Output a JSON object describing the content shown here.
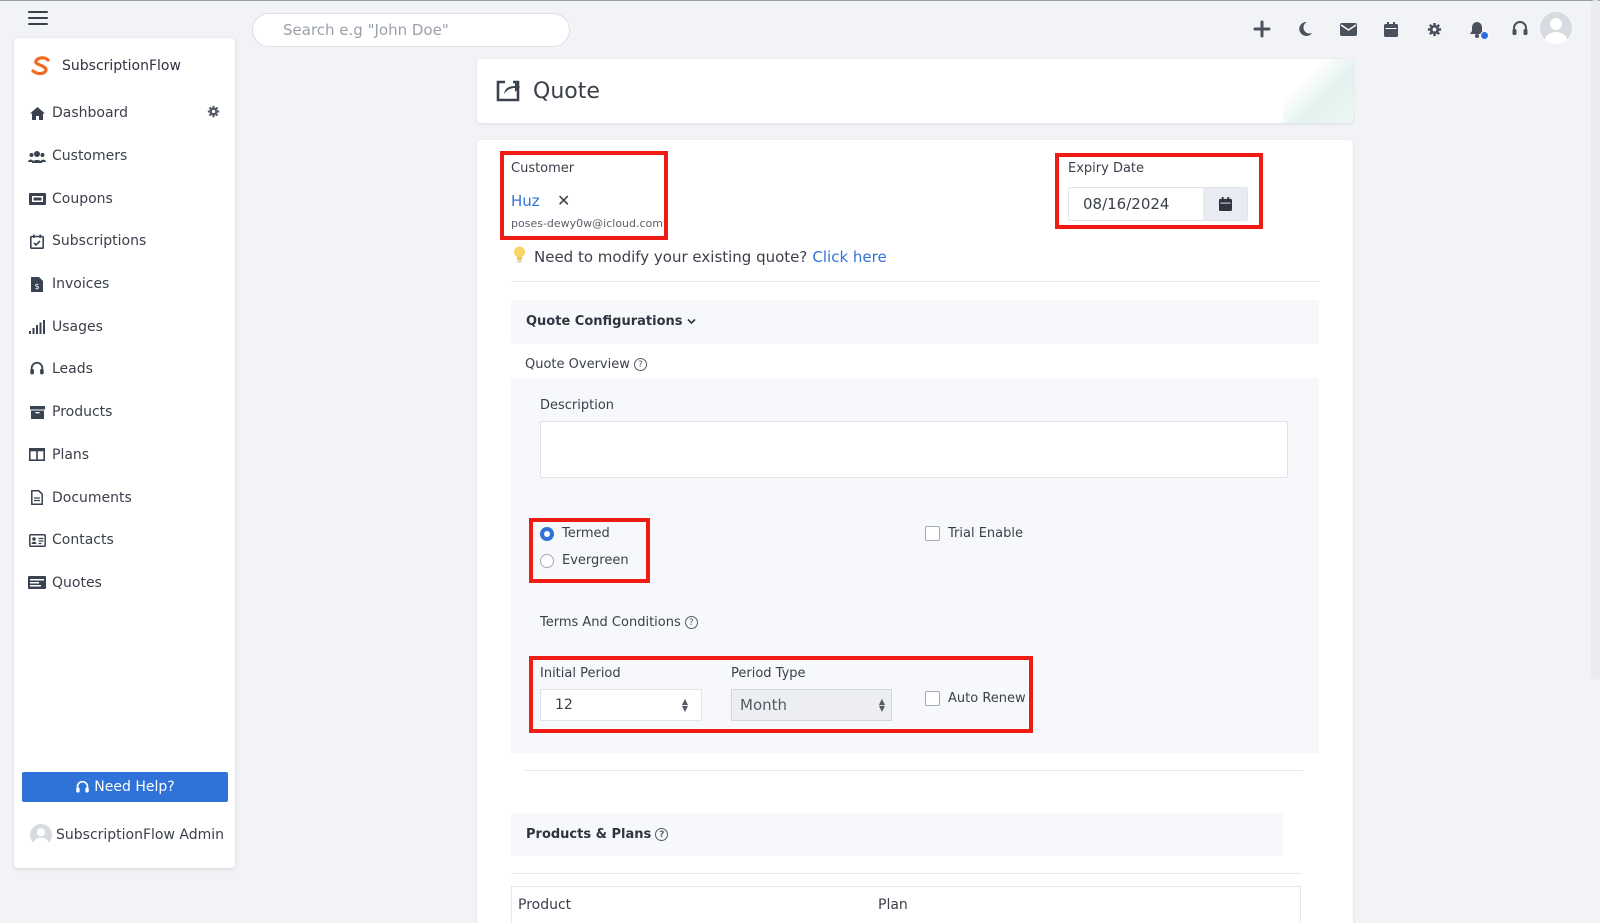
{
  "topbar": {
    "search_placeholder": "Search e.g \"John Doe\"",
    "icons": [
      "plus-icon",
      "moon-icon",
      "mail-icon",
      "calendar-icon",
      "gear-icon",
      "bell-icon",
      "headset-icon",
      "avatar"
    ]
  },
  "sidebar": {
    "brand": "SubscriptionFlow",
    "items": [
      {
        "label": "Dashboard",
        "icon": "home-icon"
      },
      {
        "label": "Customers",
        "icon": "users-icon"
      },
      {
        "label": "Coupons",
        "icon": "coupon-icon"
      },
      {
        "label": "Subscriptions",
        "icon": "calendar-check-icon"
      },
      {
        "label": "Invoices",
        "icon": "invoice-icon"
      },
      {
        "label": "Usages",
        "icon": "signal-icon"
      },
      {
        "label": "Leads",
        "icon": "headset-icon"
      },
      {
        "label": "Products",
        "icon": "archive-icon"
      },
      {
        "label": "Plans",
        "icon": "columns-icon"
      },
      {
        "label": "Documents",
        "icon": "document-icon"
      },
      {
        "label": "Contacts",
        "icon": "contact-card-icon"
      },
      {
        "label": "Quotes",
        "icon": "quotes-icon"
      }
    ],
    "help_button": "Need Help?",
    "admin_name": "SubscriptionFlow Admin"
  },
  "header": {
    "title": "Quote"
  },
  "form": {
    "customer_label": "Customer",
    "customer_name": "Huz",
    "customer_email": "poses-dewy0w@icloud.com",
    "expiry_label": "Expiry Date",
    "expiry_value": "08/16/2024",
    "hint_text": "Need to modify your existing quote?",
    "hint_link": "Click here",
    "config_title": "Quote Configurations",
    "overview_label": "Quote Overview",
    "description_label": "Description",
    "radio_termed": "Termed",
    "radio_evergreen": "Evergreen",
    "trial_label": "Trial Enable",
    "terms_label": "Terms And Conditions",
    "initial_period_label": "Initial Period",
    "initial_period_value": "12",
    "period_type_label": "Period Type",
    "period_type_value": "Month",
    "auto_renew_label": "Auto Renew",
    "products_title": "Products & Plans",
    "col_product": "Product",
    "col_plan": "Plan"
  },
  "colors": {
    "accent": "#2f73d8",
    "highlight": "#ee1c12",
    "brand_orange": "#f26b21"
  }
}
